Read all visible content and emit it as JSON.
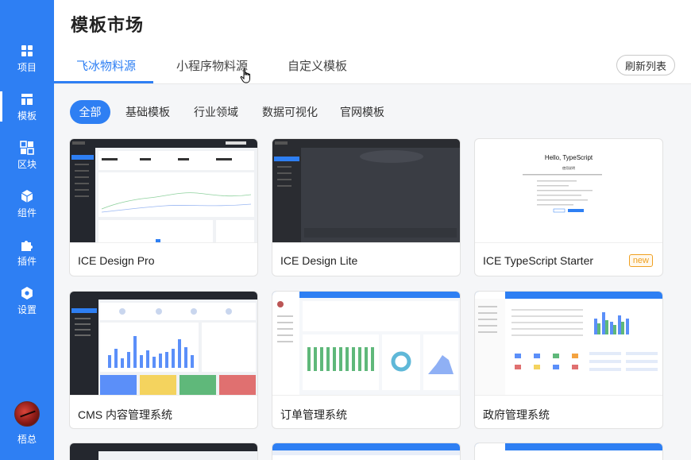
{
  "sidebar": {
    "items": [
      {
        "label": "项目",
        "icon": "grid-icon"
      },
      {
        "label": "模板",
        "icon": "layout-icon"
      },
      {
        "label": "区块",
        "icon": "blocks-icon"
      },
      {
        "label": "组件",
        "icon": "cube-icon"
      },
      {
        "label": "插件",
        "icon": "puzzle-icon"
      },
      {
        "label": "设置",
        "icon": "gear-icon"
      }
    ],
    "active": "模板",
    "user": {
      "name": "梧总"
    }
  },
  "header": {
    "title": "模板市场",
    "tabs": [
      {
        "label": "飞冰物料源"
      },
      {
        "label": "小程序物料源"
      },
      {
        "label": "自定义模板"
      }
    ],
    "active_tab": "飞冰物料源",
    "refresh_label": "刷新列表"
  },
  "filters": {
    "items": [
      {
        "label": "全部"
      },
      {
        "label": "基础模板"
      },
      {
        "label": "行业领域"
      },
      {
        "label": "数据可视化"
      },
      {
        "label": "官网模板"
      }
    ],
    "active": "全部"
  },
  "templates": [
    {
      "name": "ICE Design Pro"
    },
    {
      "name": "ICE Design Lite"
    },
    {
      "name": "ICE TypeScript Starter",
      "badge": "new",
      "preview_heading": "Hello, TypeScript",
      "preview_subheading": "使用说明"
    },
    {
      "name": "CMS 内容管理系统"
    },
    {
      "name": "订单管理系统"
    },
    {
      "name": "政府管理系统"
    }
  ],
  "colors": {
    "accent": "#2e7ff3",
    "badge": "#f0a020"
  }
}
